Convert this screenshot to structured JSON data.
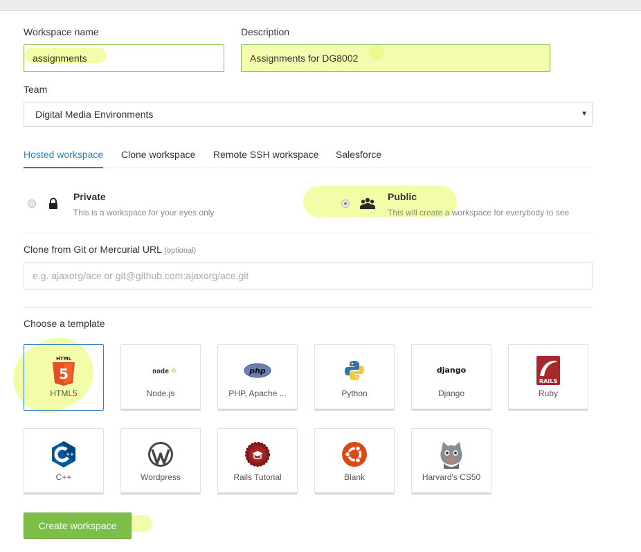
{
  "workspace_name": {
    "label": "Workspace name",
    "value": "assignments"
  },
  "description": {
    "label": "Description",
    "value": "Assignments for DG8002"
  },
  "team": {
    "label": "Team",
    "value": "Digital Media Environments"
  },
  "tabs": [
    {
      "label": "Hosted workspace",
      "active": true
    },
    {
      "label": "Clone workspace",
      "active": false
    },
    {
      "label": "Remote SSH workspace",
      "active": false
    },
    {
      "label": "Salesforce",
      "active": false
    }
  ],
  "visibility": {
    "private": {
      "title": "Private",
      "desc": "This is a workspace for your eyes only",
      "icon": "lock-icon",
      "checked": false
    },
    "public": {
      "title": "Public",
      "desc": "This will create a workspace for everybody to see",
      "icon": "group-icon",
      "checked": true
    }
  },
  "clone": {
    "label": "Clone from Git or Mercurial URL",
    "optional": "(optional)",
    "placeholder": "e.g. ajaxorg/ace or git@github.com:ajaxorg/ace.git"
  },
  "templates": {
    "label": "Choose a template",
    "items": [
      {
        "label": "HTML5",
        "icon": "html5-icon",
        "selected": true
      },
      {
        "label": "Node.js",
        "icon": "nodejs-icon",
        "selected": false
      },
      {
        "label": "PHP, Apache ...",
        "icon": "php-icon",
        "selected": false
      },
      {
        "label": "Python",
        "icon": "python-icon",
        "selected": false
      },
      {
        "label": "Django",
        "icon": "django-icon",
        "selected": false
      },
      {
        "label": "Ruby",
        "icon": "rails-icon",
        "selected": false
      },
      {
        "label": "C++",
        "icon": "cpp-icon",
        "selected": false
      },
      {
        "label": "Wordpress",
        "icon": "wordpress-icon",
        "selected": false
      },
      {
        "label": "Rails Tutorial",
        "icon": "rails-tutorial-icon",
        "selected": false
      },
      {
        "label": "Blank",
        "icon": "ubuntu-icon",
        "selected": false
      },
      {
        "label": "Harvard's CS50",
        "icon": "cat-icon",
        "selected": false
      }
    ],
    "icon_text": {
      "html5": "HTML",
      "html5_num": "5",
      "node": "node",
      "php": "php",
      "django": "django",
      "rails": "RAILS"
    }
  },
  "create_button": "Create workspace",
  "colors": {
    "accent": "#2f7fc6",
    "create": "#7cbf48",
    "highlight": "#f4fcb0"
  }
}
